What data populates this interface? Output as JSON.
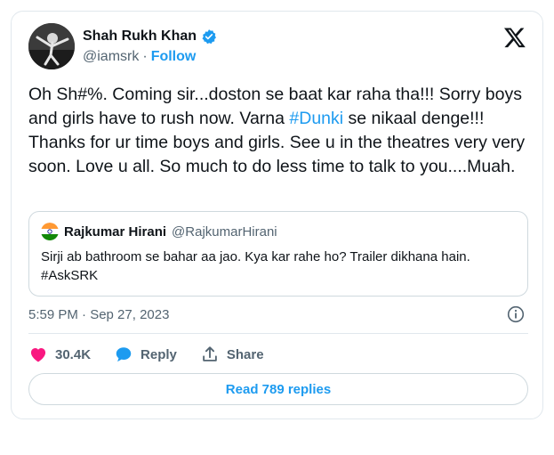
{
  "author": {
    "display_name": "Shah Rukh Khan",
    "handle": "@iamsrk",
    "separator": "·",
    "follow_label": "Follow",
    "verified_color": "#1d9bf0"
  },
  "tweet": {
    "text_before": "Oh Sh#%. Coming sir...doston se baat kar raha tha!!! Sorry boys and girls have to rush now. Varna ",
    "hashtag": "#Dunki",
    "text_after": " se nikaal denge!!! Thanks for ur time boys and girls. See u in the theatres very very soon. Love u all. So much to do less time to talk to you....Muah."
  },
  "quoted_tweet": {
    "display_name": "Rajkumar Hirani",
    "handle": "@RajkumarHirani",
    "text": "Sirji ab bathroom se bahar aa jao. Kya kar rahe ho? Trailer dikhana hain. #AskSRK",
    "avatar_icon": "india-flag-icon"
  },
  "meta": {
    "timestamp": "5:59 PM · Sep 27, 2023"
  },
  "actions": {
    "like_count": "30.4K",
    "reply_label": "Reply",
    "share_label": "Share"
  },
  "read_replies_label": "Read 789 replies",
  "colors": {
    "accent": "#1d9bf0",
    "like": "#f91880",
    "text": "#0f1419",
    "muted": "#536471"
  }
}
